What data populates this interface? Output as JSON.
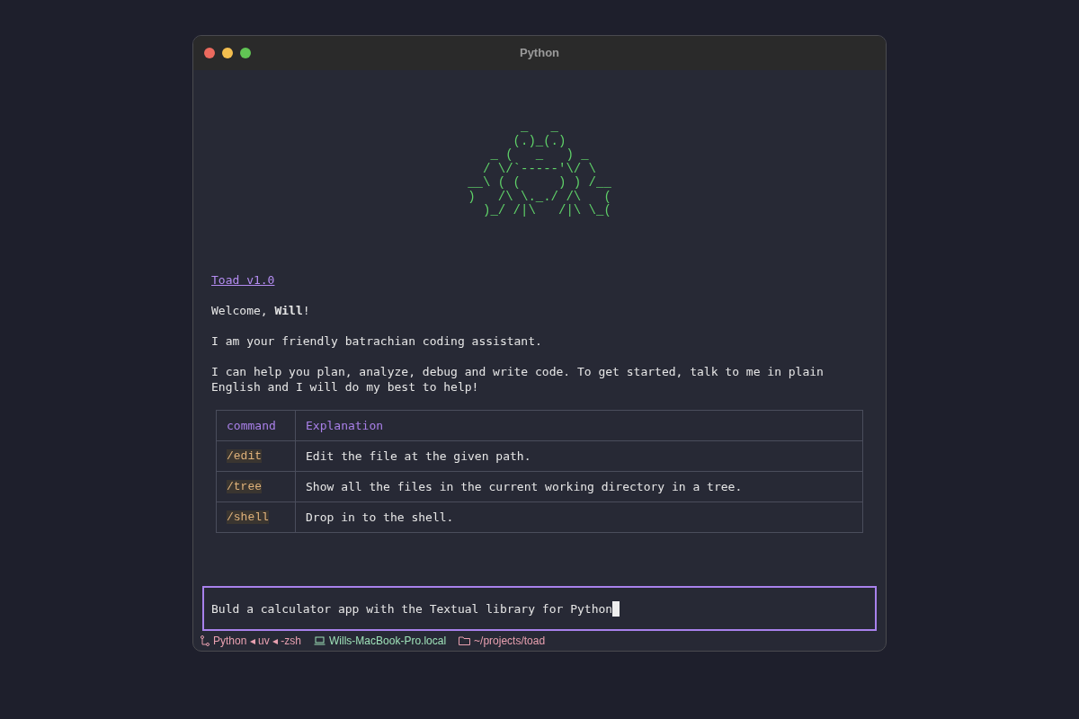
{
  "window": {
    "title": "Python"
  },
  "banner": [
    "       _   _",
    "      (.)_(.)",
    "   _ (   _   ) _",
    "  / \\/`-----'\\/ \\",
    "__\\ ( (     ) ) /__",
    ")   /\\ \\._./ /\\   (",
    "  )_/ /|\\   /|\\ \\_("
  ],
  "version_link": "Toad v1.0",
  "paragraphs": [
    "Welcome, **Will**!",
    "I am your friendly batrachian coding assistant.",
    "I can help you plan, analyze, debug and write code. To get started, talk to me in plain English and I will do my best to help!"
  ],
  "table": {
    "columns": [
      "command",
      "Explanation"
    ],
    "rows": [
      {
        "command": "/edit",
        "explanation": "Edit the file at the given path."
      },
      {
        "command": "/tree",
        "explanation": "Show all the files in the current working directory in a tree."
      },
      {
        "command": "/shell",
        "explanation": "Drop in to the shell."
      }
    ]
  },
  "prompt": {
    "value": "Buld a calculator app with the Textual library for Python"
  },
  "status_bar": {
    "process": "Python ◂ uv ◂ -zsh",
    "host": "Wills-MacBook-Pro.local",
    "path": "~/projects/toad"
  }
}
